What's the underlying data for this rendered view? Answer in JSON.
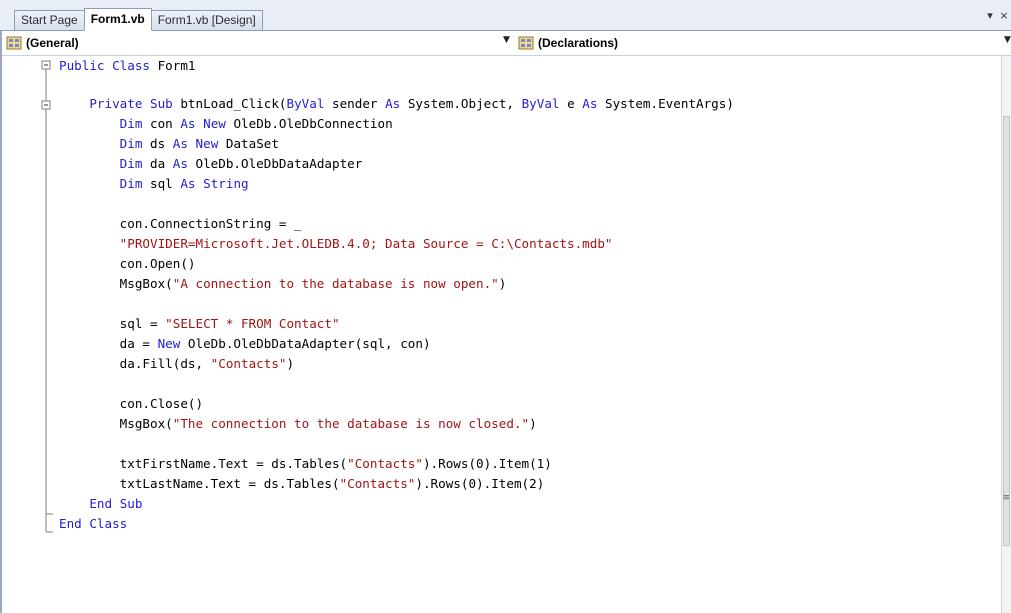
{
  "tabs": {
    "items": [
      {
        "label": "Start Page",
        "active": false
      },
      {
        "label": "Form1.vb",
        "active": true
      },
      {
        "label": "Form1.vb [Design]",
        "active": false
      }
    ],
    "controls": {
      "pin": "▾",
      "close": "×"
    }
  },
  "navbar": {
    "object_combo": {
      "selected": "(General)",
      "icon": "class-icon"
    },
    "member_combo": {
      "selected": "(Declarations)",
      "icon": "declarations-icon"
    },
    "arrow": "▼"
  },
  "code": {
    "lines": [
      {
        "text": "Public Class Form1"
      },
      {
        "text": ""
      },
      {
        "text": "    Private Sub btnLoad_Click(ByVal sender As System.Object, ByVal e As System.EventArgs)"
      },
      {
        "text": "        Dim con As New OleDb.OleDbConnection"
      },
      {
        "text": "        Dim ds As New DataSet"
      },
      {
        "text": "        Dim da As OleDb.OleDbDataAdapter"
      },
      {
        "text": "        Dim sql As String"
      },
      {
        "text": ""
      },
      {
        "text": "        con.ConnectionString = _"
      },
      {
        "text": "        \"PROVIDER=Microsoft.Jet.OLEDB.4.0; Data Source = C:\\Contacts.mdb\""
      },
      {
        "text": "        con.Open()"
      },
      {
        "text": "        MsgBox(\"A connection to the database is now open.\")"
      },
      {
        "text": ""
      },
      {
        "text": "        sql = \"SELECT * FROM Contact\""
      },
      {
        "text": "        da = New OleDb.OleDbDataAdapter(sql, con)"
      },
      {
        "text": "        da.Fill(ds, \"Contacts\")"
      },
      {
        "text": ""
      },
      {
        "text": "        con.Close()"
      },
      {
        "text": "        MsgBox(\"The connection to the database is now closed.\")"
      },
      {
        "text": ""
      },
      {
        "text": "        txtFirstName.Text = ds.Tables(\"Contacts\").Rows(0).Item(1)"
      },
      {
        "text": "        txtLastName.Text = ds.Tables(\"Contacts\").Rows(0).Item(2)"
      },
      {
        "text": "    End Sub"
      },
      {
        "text": "End Class"
      }
    ]
  },
  "colors": {
    "keyword": "#1f1fd0",
    "string": "#a31515",
    "text": "#000000",
    "outline": "#7f7f7f"
  }
}
